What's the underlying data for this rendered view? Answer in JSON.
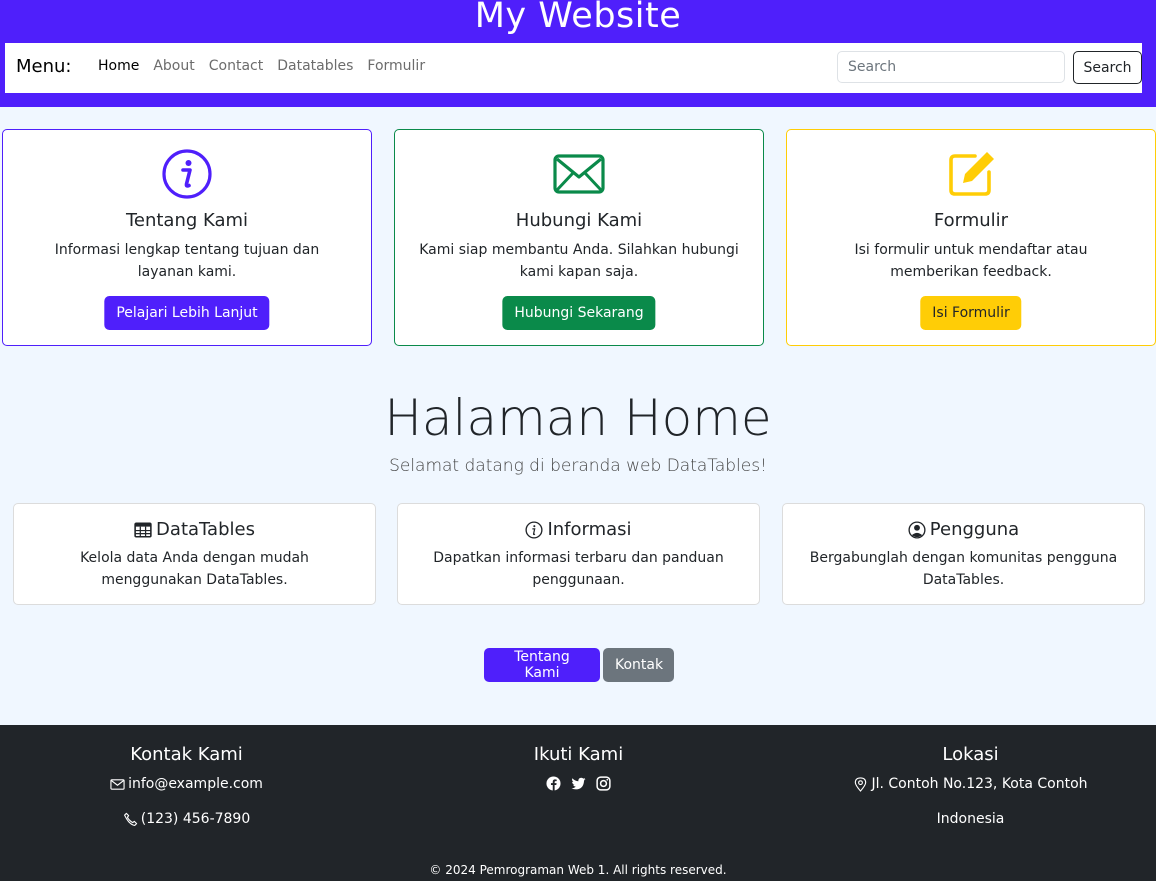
{
  "header": {
    "site_title": "My Website",
    "brand": "Menu:",
    "nav": [
      "Home",
      "About",
      "Contact",
      "Datatables",
      "Formulir"
    ],
    "search_placeholder": "Search",
    "search_button": "Search"
  },
  "colors": {
    "primary": "#4f1ffb",
    "success": "#0a8a4a",
    "warning": "#ffcd06",
    "secondary": "#6c757d",
    "dark": "#212529"
  },
  "feature_cards": [
    {
      "icon": "info-circle-icon",
      "title": "Tentang Kami",
      "text": "Informasi lengkap tentang tujuan dan layanan kami.",
      "button": "Pelajari Lebih Lanjut"
    },
    {
      "icon": "envelope-icon",
      "title": "Hubungi Kami",
      "text": "Kami siap membantu Anda. Silahkan hubungi kami kapan saja.",
      "button": "Hubungi Sekarang"
    },
    {
      "icon": "edit-icon",
      "title": "Formulir",
      "text": "Isi formulir untuk mendaftar atau memberikan feedback.",
      "button": "Isi Formulir"
    }
  ],
  "hero": {
    "title": "Halaman Home",
    "subtitle": "Selamat datang di beranda web DataTables!"
  },
  "info_cards": [
    {
      "icon": "table-icon",
      "title": "DataTables",
      "text": "Kelola data Anda dengan mudah menggunakan DataTables."
    },
    {
      "icon": "info-circle-icon",
      "title": "Informasi",
      "text": "Dapatkan informasi terbaru dan panduan penggunaan."
    },
    {
      "icon": "user-circle-icon",
      "title": "Pengguna",
      "text": "Bergabunglah dengan komunitas pengguna DataTables."
    }
  ],
  "cta": {
    "primary": "Tentang Kami",
    "secondary": "Kontak"
  },
  "footer": {
    "contact_title": "Kontak Kami",
    "email": "info@example.com",
    "phone": "(123) 456-7890",
    "follow_title": "Ikuti Kami",
    "socials": [
      "facebook-icon",
      "twitter-icon",
      "instagram-icon"
    ],
    "location_title": "Lokasi",
    "address": "Jl. Contoh No.123, Kota Contoh",
    "country": "Indonesia",
    "copyright": "© 2024 Pemrograman Web 1. All rights reserved."
  }
}
